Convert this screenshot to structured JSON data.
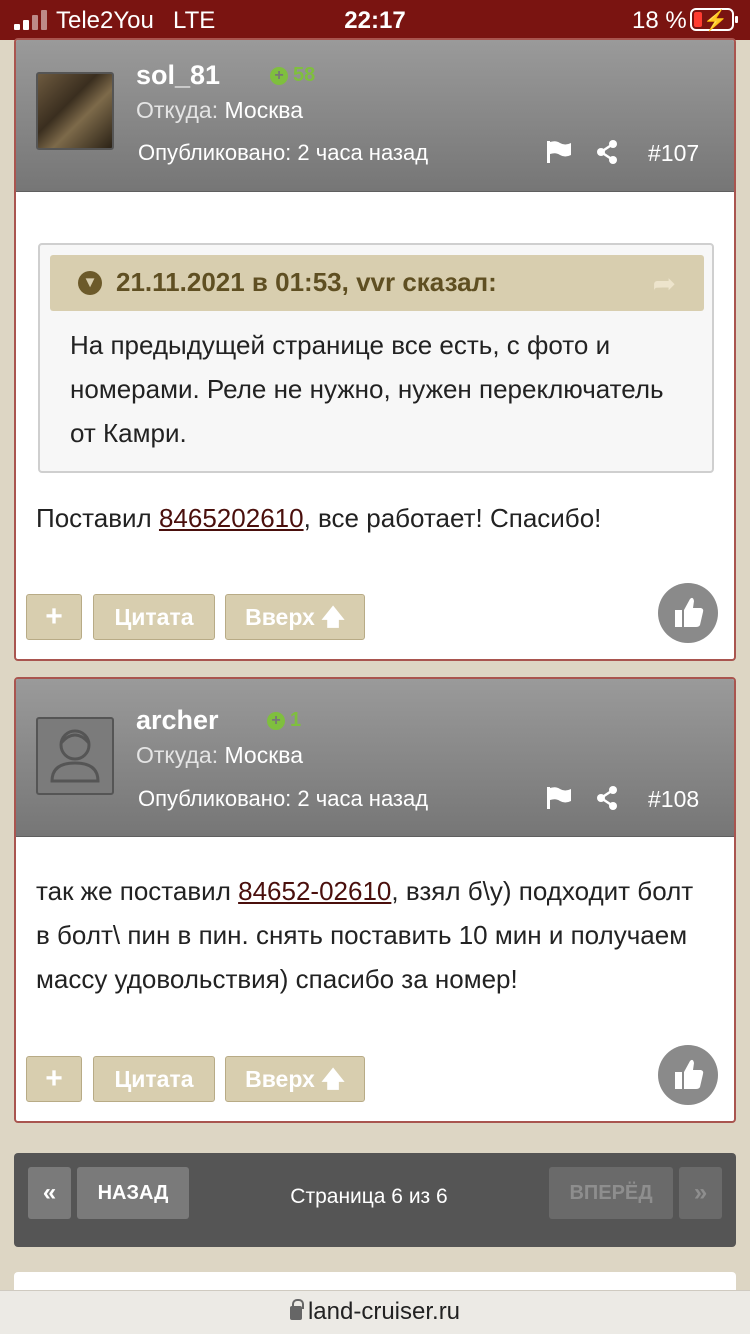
{
  "status_bar": {
    "carrier": "Tele2You",
    "network": "LTE",
    "time": "22:17",
    "battery": "18 %"
  },
  "posts": [
    {
      "username": "sol_81",
      "reputation": "58",
      "location_label": "Откуда:",
      "location": "Москва",
      "published": "Опубликовано: 2 часа назад",
      "number": "#107",
      "quote": {
        "title": "21.11.2021 в 01:53, vvr сказал:",
        "text": "На предыдущей странице все есть, с фото и номерами. Реле не нужно, нужен переключатель от Камри."
      },
      "body_before": "Поставил ",
      "body_link": "8465202610",
      "body_after": ", все работает! Спасибо!"
    },
    {
      "username": "archer",
      "reputation": "1",
      "location_label": "Откуда:",
      "location": "Москва",
      "published": "Опубликовано: 2 часа назад",
      "number": "#108",
      "body_before": "так же поставил ",
      "body_link": "84652-02610",
      "body_after": ", взял б\\у) подходит болт в болт\\ пин в пин. снять поставить 10 мин и получаем массу удовольствия) спасибо за номер!"
    }
  ],
  "actions": {
    "plus_label": "+",
    "quote_label": "Цитата",
    "up_label": "Вверх"
  },
  "pager": {
    "first": "«",
    "back": "НАЗАД",
    "info": "Страница 6 из 6",
    "forward": "ВПЕРЁД",
    "last": "»"
  },
  "url": "land-cruiser.ru",
  "colors": {
    "status_bar": "#7a1411",
    "post_border": "#a9554f",
    "button": "#d8ceaf",
    "reputation": "#7fbf3e",
    "page_bg": "#ddd6c4"
  }
}
